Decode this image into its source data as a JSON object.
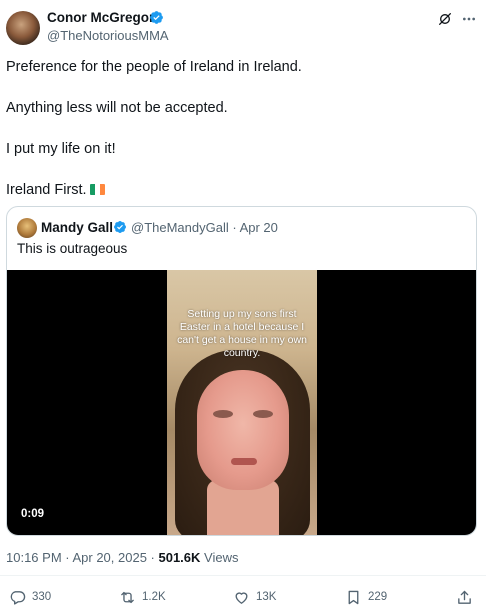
{
  "author": {
    "name": "Conor McGregor",
    "handle": "@TheNotoriousMMA"
  },
  "tweet": {
    "lines": [
      "Preference for the people of Ireland in Ireland.",
      "Anything less will not be accepted.",
      "I put my life on it!",
      "Ireland First."
    ],
    "flag_colors": [
      "#169b62",
      "#ffffff",
      "#ff883e"
    ]
  },
  "quote": {
    "name": "Mandy Gall",
    "handle_meta": "@TheMandyGall · Apr 20",
    "text": "This is outrageous",
    "video": {
      "overlay_text": "Setting up my sons first Easter in a hotel because I can't get a house in my own country.",
      "duration": "0:09"
    }
  },
  "meta": {
    "timestamp": "10:16 PM · Apr 20, 2025 · ",
    "views_count": "501.6K",
    "views_label": " Views"
  },
  "actions": {
    "replies": "330",
    "reposts": "1.2K",
    "likes": "13K",
    "bookmarks": "229"
  },
  "icons": {
    "verified": "verified-badge-icon",
    "grok": "grok-icon",
    "more": "more-icon",
    "reply": "reply-icon",
    "repost": "repost-icon",
    "like": "heart-icon",
    "bookmark": "bookmark-icon",
    "share": "share-icon"
  },
  "colors": {
    "verified_blue": "#1d9bf0",
    "muted_text": "#536471",
    "text": "#0f1419"
  }
}
